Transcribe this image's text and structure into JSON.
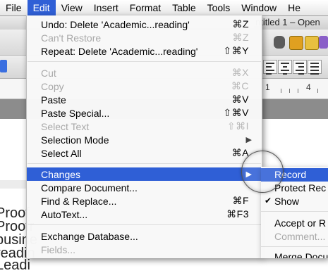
{
  "menubar": {
    "items": [
      {
        "label": "File",
        "active": false
      },
      {
        "label": "Edit",
        "active": true
      },
      {
        "label": "View",
        "active": false
      },
      {
        "label": "Insert",
        "active": false
      },
      {
        "label": "Format",
        "active": false
      },
      {
        "label": "Table",
        "active": false
      },
      {
        "label": "Tools",
        "active": false
      },
      {
        "label": "Window",
        "active": false
      },
      {
        "label": "He",
        "active": false
      }
    ]
  },
  "window": {
    "title_fragment": "ntitled 1 – Open"
  },
  "ruler": {
    "num_1": "1",
    "num_4": "4"
  },
  "document": {
    "lines": [
      "Proof",
      "Proofr",
      "busine",
      "readin",
      "Leadi"
    ]
  },
  "edit_menu": {
    "items": [
      {
        "label": "Undo: Delete 'Academic...reading'",
        "shortcut": "⌘Z",
        "disabled": false
      },
      {
        "label": "Can't Restore",
        "shortcut": "⌘Z",
        "disabled": true
      },
      {
        "label": "Repeat: Delete 'Academic...reading'",
        "shortcut": "⇧⌘Y",
        "disabled": false
      },
      {
        "label": "Cut",
        "shortcut": "⌘X",
        "disabled": true
      },
      {
        "label": "Copy",
        "shortcut": "⌘C",
        "disabled": true
      },
      {
        "label": "Paste",
        "shortcut": "⌘V",
        "disabled": false
      },
      {
        "label": "Paste Special...",
        "shortcut": "⇧⌘V",
        "disabled": false
      },
      {
        "label": "Select Text",
        "shortcut": "⇧⌘I",
        "disabled": true
      },
      {
        "label": "Selection Mode",
        "shortcut": "",
        "submenu": true,
        "disabled": false
      },
      {
        "label": "Select All",
        "shortcut": "⌘A",
        "disabled": false
      },
      {
        "label": "Changes",
        "shortcut": "",
        "submenu": true,
        "highlighted": true,
        "disabled": false
      },
      {
        "label": "Compare Document...",
        "shortcut": "",
        "disabled": false
      },
      {
        "label": "Find & Replace...",
        "shortcut": "⌘F",
        "disabled": false
      },
      {
        "label": "AutoText...",
        "shortcut": "⌘F3",
        "disabled": false
      },
      {
        "label": "Exchange Database...",
        "shortcut": "",
        "disabled": false
      },
      {
        "label": "Fields...",
        "shortcut": "",
        "disabled": true
      }
    ]
  },
  "changes_submenu": {
    "items": [
      {
        "label": "Record",
        "highlighted": true,
        "checked": false,
        "disabled": false
      },
      {
        "label": "Protect Rec",
        "highlighted": false,
        "checked": false,
        "disabled": false
      },
      {
        "label": "Show",
        "highlighted": false,
        "checked": true,
        "disabled": false
      },
      {
        "label": "Accept or R",
        "highlighted": false,
        "checked": false,
        "disabled": false
      },
      {
        "label": "Comment...",
        "highlighted": false,
        "checked": false,
        "disabled": true
      },
      {
        "label": "Merge Docu",
        "highlighted": false,
        "checked": false,
        "disabled": false
      }
    ]
  },
  "colors": {
    "highlight": "#2f5fd6"
  }
}
